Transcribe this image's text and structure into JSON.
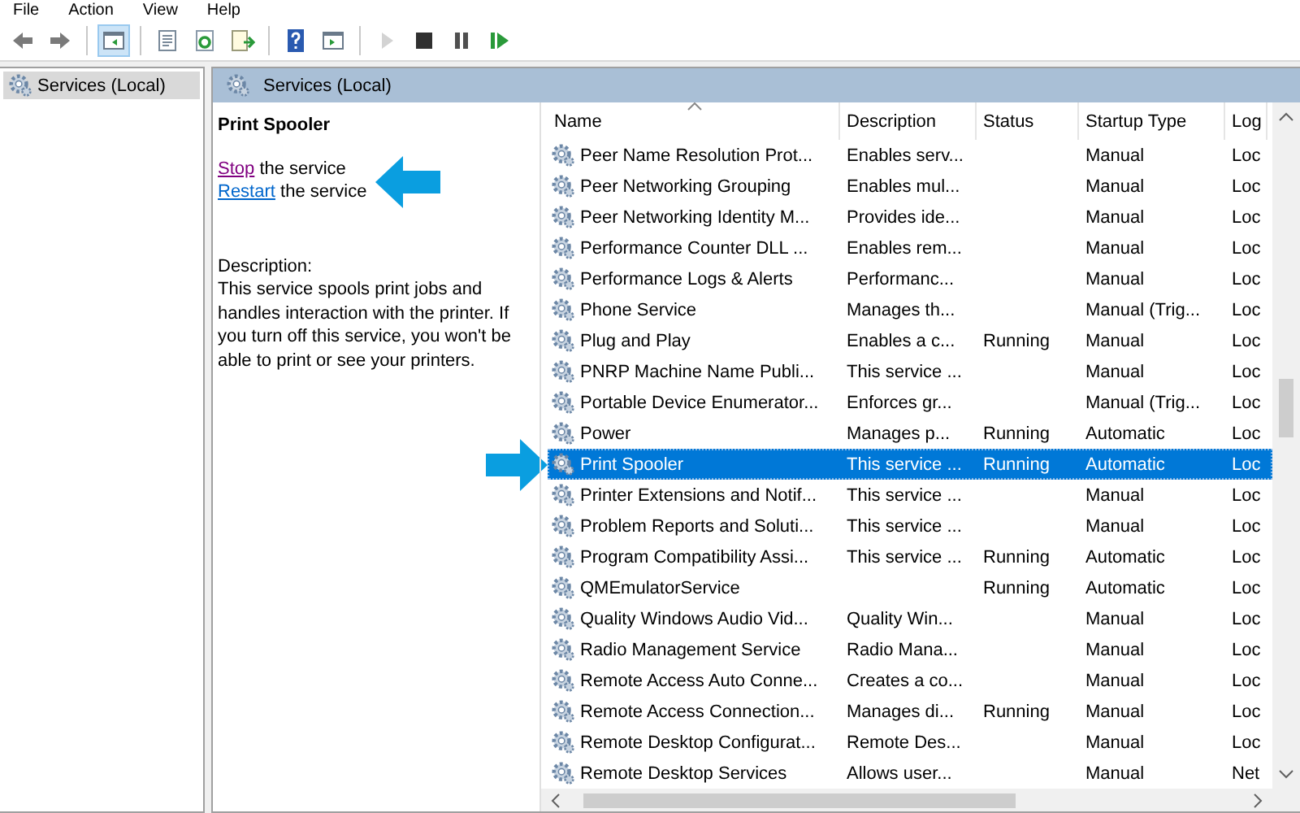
{
  "menu": [
    "File",
    "Action",
    "View",
    "Help"
  ],
  "toolbar": [
    {
      "kind": "back",
      "pressed": false,
      "disabled": false
    },
    {
      "kind": "forward",
      "pressed": false,
      "disabled": false
    },
    {
      "kind": "tree",
      "pressed": true,
      "disabled": false
    },
    {
      "kind": "properties",
      "pressed": false,
      "disabled": false
    },
    {
      "kind": "refresh",
      "pressed": false,
      "disabled": false
    },
    {
      "kind": "export",
      "pressed": false,
      "disabled": false
    },
    {
      "kind": "help",
      "pressed": false,
      "disabled": false
    },
    {
      "kind": "pane",
      "pressed": false,
      "disabled": false
    },
    {
      "kind": "start",
      "pressed": false,
      "disabled": true
    },
    {
      "kind": "stop",
      "pressed": false,
      "disabled": false
    },
    {
      "kind": "pause",
      "pressed": false,
      "disabled": false
    },
    {
      "kind": "resume",
      "pressed": false,
      "disabled": false
    }
  ],
  "tree": {
    "label": "Services (Local)",
    "selected": true
  },
  "pane_header": "Services (Local)",
  "details": {
    "title": "Print Spooler",
    "actions": [
      {
        "link": "Stop",
        "text": "the service",
        "visited": true
      },
      {
        "link": "Restart",
        "text": "the service",
        "visited": false
      }
    ],
    "description_label": "Description:",
    "description": "This service spools print jobs and handles interaction with the printer. If you turn off this service, you won't be able to print or see your printers."
  },
  "table": {
    "columns": [
      {
        "label": "Name",
        "sorted": true
      },
      {
        "label": "Description",
        "sorted": false
      },
      {
        "label": "Status",
        "sorted": false
      },
      {
        "label": "Startup Type",
        "sorted": false
      },
      {
        "label": "Log",
        "sorted": false
      }
    ],
    "rows": [
      {
        "name": "Peer Name Resolution Prot...",
        "description": "Enables serv...",
        "status": "",
        "startup": "Manual",
        "logon": "Loc",
        "selected": false
      },
      {
        "name": "Peer Networking Grouping",
        "description": "Enables mul...",
        "status": "",
        "startup": "Manual",
        "logon": "Loc",
        "selected": false
      },
      {
        "name": "Peer Networking Identity M...",
        "description": "Provides ide...",
        "status": "",
        "startup": "Manual",
        "logon": "Loc",
        "selected": false
      },
      {
        "name": "Performance Counter DLL ...",
        "description": "Enables rem...",
        "status": "",
        "startup": "Manual",
        "logon": "Loc",
        "selected": false
      },
      {
        "name": "Performance Logs & Alerts",
        "description": "Performanc...",
        "status": "",
        "startup": "Manual",
        "logon": "Loc",
        "selected": false
      },
      {
        "name": "Phone Service",
        "description": "Manages th...",
        "status": "",
        "startup": "Manual (Trig...",
        "logon": "Loc",
        "selected": false
      },
      {
        "name": "Plug and Play",
        "description": "Enables a c...",
        "status": "Running",
        "startup": "Manual",
        "logon": "Loc",
        "selected": false
      },
      {
        "name": "PNRP Machine Name Publi...",
        "description": "This service ...",
        "status": "",
        "startup": "Manual",
        "logon": "Loc",
        "selected": false
      },
      {
        "name": "Portable Device Enumerator...",
        "description": "Enforces gr...",
        "status": "",
        "startup": "Manual (Trig...",
        "logon": "Loc",
        "selected": false
      },
      {
        "name": "Power",
        "description": "Manages p...",
        "status": "Running",
        "startup": "Automatic",
        "logon": "Loc",
        "selected": false
      },
      {
        "name": "Print Spooler",
        "description": "This service ...",
        "status": "Running",
        "startup": "Automatic",
        "logon": "Loc",
        "selected": true
      },
      {
        "name": "Printer Extensions and Notif...",
        "description": "This service ...",
        "status": "",
        "startup": "Manual",
        "logon": "Loc",
        "selected": false
      },
      {
        "name": "Problem Reports and Soluti...",
        "description": "This service ...",
        "status": "",
        "startup": "Manual",
        "logon": "Loc",
        "selected": false
      },
      {
        "name": "Program Compatibility Assi...",
        "description": "This service ...",
        "status": "Running",
        "startup": "Automatic",
        "logon": "Loc",
        "selected": false
      },
      {
        "name": "QMEmulatorService",
        "description": "",
        "status": "Running",
        "startup": "Automatic",
        "logon": "Loc",
        "selected": false
      },
      {
        "name": "Quality Windows Audio Vid...",
        "description": "Quality Win...",
        "status": "",
        "startup": "Manual",
        "logon": "Loc",
        "selected": false
      },
      {
        "name": "Radio Management Service",
        "description": "Radio Mana...",
        "status": "",
        "startup": "Manual",
        "logon": "Loc",
        "selected": false
      },
      {
        "name": "Remote Access Auto Conne...",
        "description": "Creates a co...",
        "status": "",
        "startup": "Manual",
        "logon": "Loc",
        "selected": false
      },
      {
        "name": "Remote Access Connection...",
        "description": "Manages di...",
        "status": "Running",
        "startup": "Manual",
        "logon": "Loc",
        "selected": false
      },
      {
        "name": "Remote Desktop Configurat...",
        "description": "Remote Des...",
        "status": "",
        "startup": "Manual",
        "logon": "Loc",
        "selected": false
      },
      {
        "name": "Remote Desktop Services",
        "description": "Allows user...",
        "status": "",
        "startup": "Manual",
        "logon": "Net",
        "selected": false
      }
    ]
  }
}
